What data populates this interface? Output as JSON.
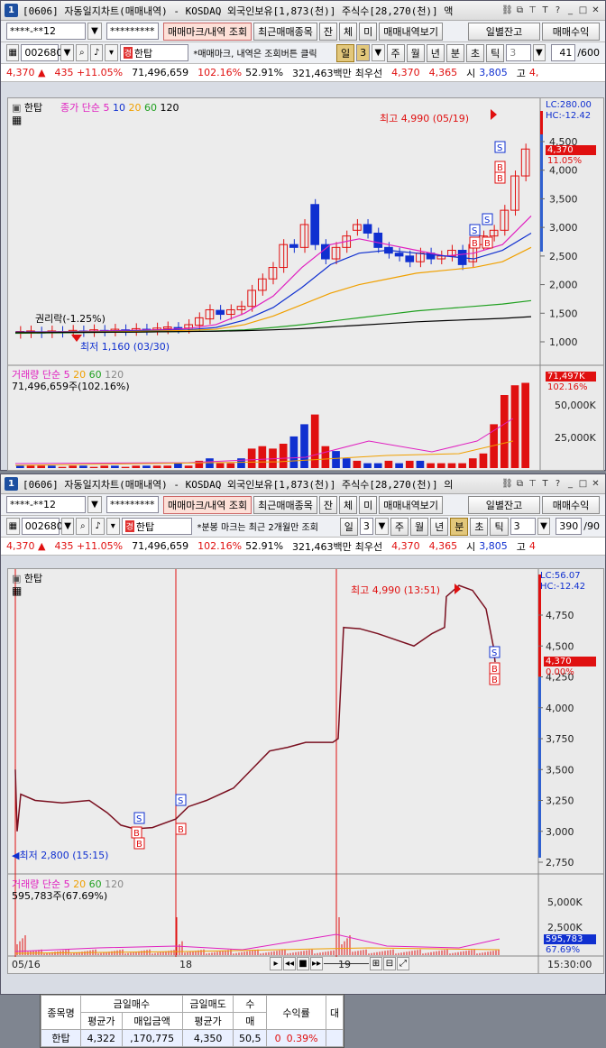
{
  "window_top": {
    "number": "1",
    "title": "[0606] 자동일지차트(매매내역) - KOSDAQ 외국인보유[1,873(천)] 주식수[28,270(천)] 액",
    "toolbar1": {
      "account": "****-**12",
      "password": "*********",
      "trade_mark_btn": "매매마크/내역 조회",
      "recent_btn": "최근매매종목",
      "jan_btn": "잔",
      "che_btn": "체",
      "mi_btn": "미",
      "view_btn": "매매내역보기",
      "daily_btn": "일별잔고",
      "profit_btn": "매매수익"
    },
    "toolbar2": {
      "code": "002680",
      "name": "한탑",
      "hint": "*매매마크, 내역은 조회버튼 클릭",
      "period_il": "일",
      "period_val": "3",
      "ju": "주",
      "wol": "월",
      "nyeon": "년",
      "bun": "분",
      "cho": "초",
      "tik": "틱",
      "num": "3",
      "count": "41",
      "count_total": "/600"
    },
    "quote": {
      "price": "4,370",
      "arrow": "▲",
      "change": "435",
      "rate": "+11.05%",
      "volume": "71,496,659",
      "vol_ratio": "102.16%",
      "pct": "52.91%",
      "amount": "321,463백만",
      "best": "최우선",
      "ask": "4,370",
      "bid": "4,365",
      "si": "시",
      "open": "3,805",
      "go": "고",
      "high": "4,"
    },
    "chart": {
      "name": "한탑",
      "legend_title": "종가 단순",
      "ma": [
        "5",
        "10",
        "20",
        "60",
        "120"
      ],
      "max_label": "최고 4,990 (05/19)",
      "min_label": "최저 1,160 (03/30)",
      "rights_label": "권리락(-1.25%)",
      "lc": "LC:280.00",
      "hc": "HC:-12.42",
      "price_tag": "4,370",
      "rate_tag": "11.05%",
      "yticks": [
        "4,500",
        "4,000",
        "3,500",
        "3,000",
        "2,500",
        "2,000",
        "1,500",
        "1,000"
      ],
      "vol_legend": "거래량 단순",
      "vol_ma": [
        "5",
        "20",
        "60",
        "120"
      ],
      "vol_value": "71,496,659주(102.16%)",
      "vol_tag": "71,497K",
      "vol_rate_tag": "102.16%",
      "vol_yticks": [
        "50,000K",
        "25,000K"
      ]
    }
  },
  "window_bottom": {
    "number": "1",
    "title": "[0606] 자동일지차트(매매내역) - KOSDAQ 외국인보유[1,873(천)] 주식수[28,270(천)] 의",
    "toolbar1": {
      "account": "****-**12",
      "password": "*********",
      "trade_mark_btn": "매매마크/내역 조회",
      "recent_btn": "최근매매종목",
      "jan_btn": "잔",
      "che_btn": "체",
      "mi_btn": "미",
      "view_btn": "매매내역보기",
      "daily_btn": "일별잔고",
      "profit_btn": "매매수익"
    },
    "toolbar2": {
      "code": "002680",
      "name": "한탑",
      "hint": "*분봉 마크는 최근 2개월만 조회",
      "period_il": "일",
      "period_val": "3",
      "ju": "주",
      "wol": "월",
      "nyeon": "년",
      "bun": "분",
      "cho": "초",
      "tik": "틱",
      "num": "3",
      "count": "390",
      "count_total": "/90"
    },
    "quote": {
      "price": "4,370",
      "arrow": "▲",
      "change": "435",
      "rate": "+11.05%",
      "volume": "71,496,659",
      "vol_ratio": "102.16%",
      "pct": "52.91%",
      "amount": "321,463백만",
      "best": "최우선",
      "ask": "4,370",
      "bid": "4,365",
      "si": "시",
      "open": "3,805",
      "go": "고",
      "high": "4"
    },
    "chart": {
      "name": "한탑",
      "max_label": "최고 4,990 (13:51)",
      "min_label": "최저 2,800 (15:15)",
      "lc": "LC:56.07",
      "hc": "HC:-12.42",
      "price_tag": "4,370",
      "rate_tag": "0.00%",
      "yticks": [
        "4,750",
        "4,500",
        "4,250",
        "4,000",
        "3,750",
        "3,500",
        "3,250",
        "3,000",
        "2,750"
      ],
      "vol_legend": "거래량 단순",
      "vol_ma": [
        "5",
        "20",
        "60",
        "120"
      ],
      "vol_value": "595,783주(67.69%)",
      "vol_tag": "595,783",
      "vol_rate_tag": "67.69%",
      "vol_yticks": [
        "5,000K",
        "2,500K"
      ],
      "xlabels": [
        "05/16",
        "18",
        "19"
      ],
      "time_label": "15:30:00"
    }
  },
  "table": {
    "headers_row1": [
      "종목명",
      "금일매수",
      "금일매도",
      "수",
      "수익률",
      "대"
    ],
    "headers_row2": [
      "",
      "평균가",
      "매입금액",
      "평균가",
      "매",
      "",
      ""
    ],
    "row": [
      "한탑",
      "4,322",
      ",170,775",
      "4,350",
      "50,5",
      "0",
      "0.39%",
      ""
    ]
  },
  "colors": {
    "up": "#e01010",
    "down": "#1030d0",
    "ma5": "#e020c0",
    "ma10": "#1030d0",
    "ma20": "#f0a000",
    "ma60": "#20a020",
    "ma120": "#000000"
  }
}
